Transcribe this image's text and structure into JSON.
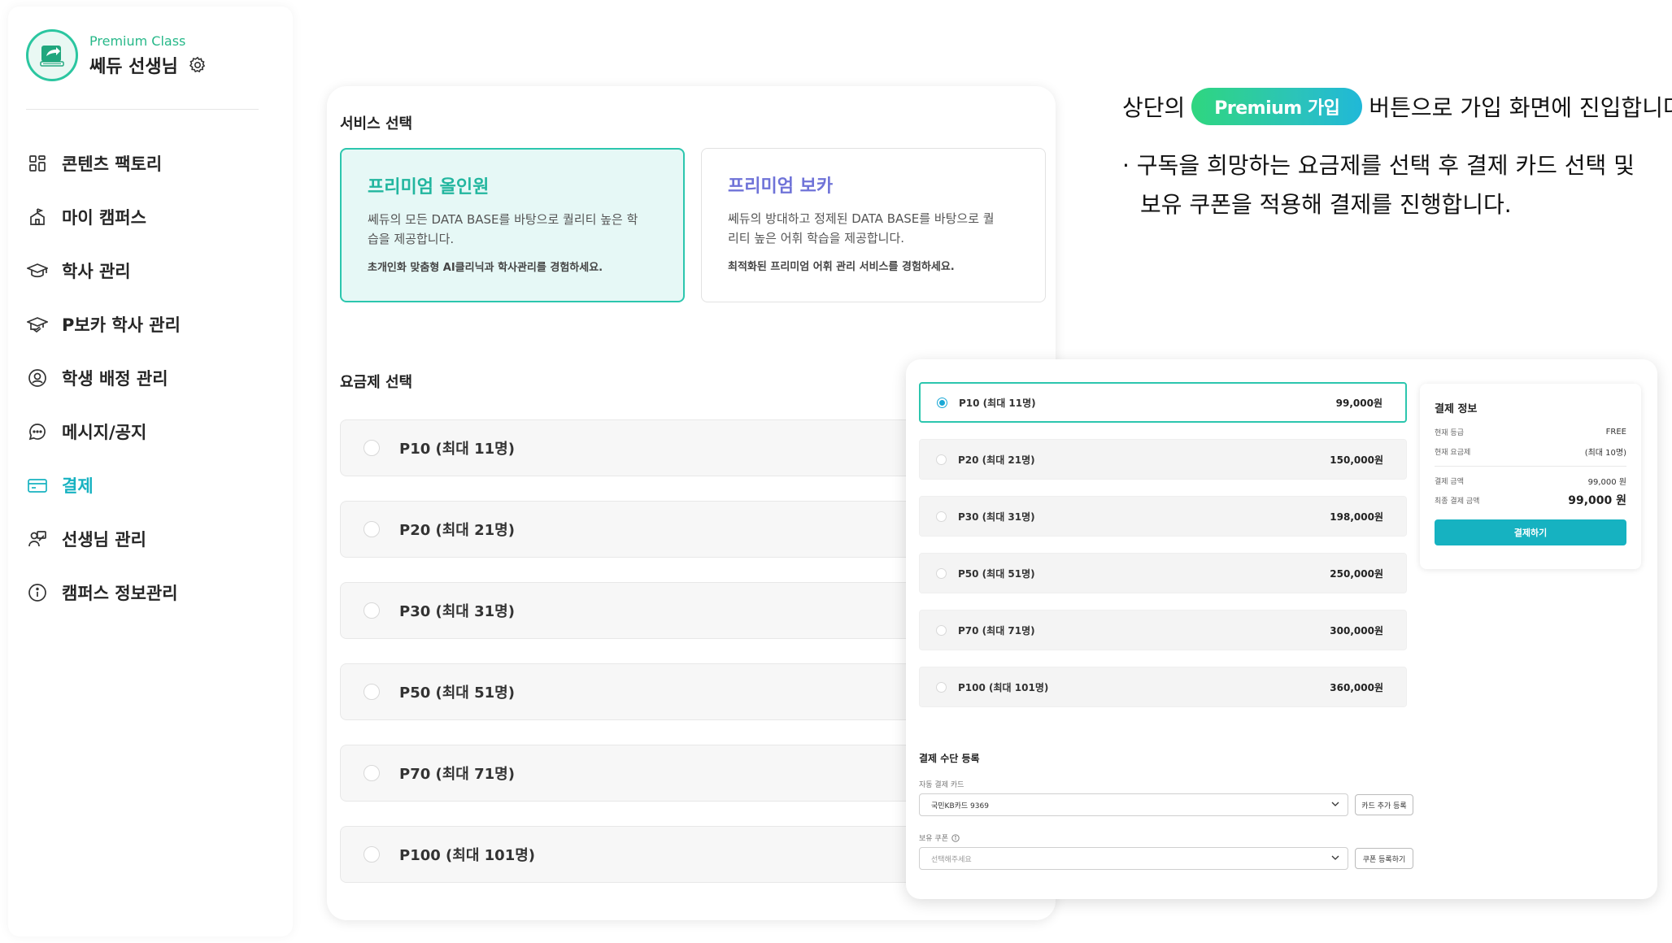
{
  "profile": {
    "class_label": "Premium Class",
    "name": "쎄듀 선생님"
  },
  "menu": [
    {
      "label": "콘텐츠 팩토리",
      "icon": "content-factory-icon"
    },
    {
      "label": "마이 캠퍼스",
      "icon": "campus-icon"
    },
    {
      "label": "학사 관리",
      "icon": "graduation-cap-icon"
    },
    {
      "label": "P보카 학사 관리",
      "icon": "graduation-cap-book-icon"
    },
    {
      "label": "학생 배정 관리",
      "icon": "student-assign-icon"
    },
    {
      "label": "메시지/공지",
      "icon": "message-icon"
    },
    {
      "label": "결제",
      "icon": "credit-card-icon",
      "active": true
    },
    {
      "label": "선생님 관리",
      "icon": "teacher-icon"
    },
    {
      "label": "캠퍼스 정보관리",
      "icon": "info-icon"
    }
  ],
  "main": {
    "service_title": "서비스 선택",
    "services": [
      {
        "title": "프리미엄 올인원",
        "desc": "쎄듀의 모든 DATA BASE를 바탕으로 퀄리티 높은 학습을 제공합니다.",
        "note": "초개인화 맞춤형 AI클리닉과 학사관리를 경험하세요."
      },
      {
        "title": "프리미엄 보카",
        "desc": "쎄듀의 방대하고 정제된 DATA BASE를 바탕으로 퀄리티 높은 어휘 학습을 제공합니다.",
        "note": "최적화된 프리미엄 어휘 관리 서비스를 경험하세요."
      }
    ],
    "plan_title": "요금제 선택",
    "plans": [
      "P10 (최대 11명)",
      "P20 (최대 21명)",
      "P30 (최대 31명)",
      "P50 (최대 51명)",
      "P70 (최대 71명)",
      "P100 (최대 101명)"
    ]
  },
  "overlay": {
    "plans": [
      {
        "label": "P10 (최대 11명)",
        "price": "99,000원",
        "selected": true
      },
      {
        "label": "P20 (최대 21명)",
        "price": "150,000원"
      },
      {
        "label": "P30 (최대 31명)",
        "price": "198,000원"
      },
      {
        "label": "P50 (최대 51명)",
        "price": "250,000원"
      },
      {
        "label": "P70 (최대 71명)",
        "price": "300,000원"
      },
      {
        "label": "P100 (최대 101명)",
        "price": "360,000원"
      }
    ],
    "payment_info": {
      "title": "결제 정보",
      "current_grade_label": "현재 등급",
      "current_grade": "FREE",
      "current_plan_label": "현재 요금제",
      "current_plan": "(최대 10명)",
      "amount_label": "결제 금액",
      "amount": "99,000 원",
      "final_label": "최종 결제 금액",
      "final_amount": "99,000 원",
      "pay_button": "결제하기"
    },
    "register": {
      "title": "결제 수단 등록",
      "card_label": "자동 결제 카드",
      "card_value": "국민KB카드 9369",
      "add_card_button": "카드 추가 등록",
      "coupon_label": "보유 쿠폰",
      "coupon_placeholder": "선택해주세요",
      "coupon_button": "쿠폰 등록하기"
    }
  },
  "annotation": {
    "prefix": "상단의",
    "pill": "Premium 가입",
    "suffix": "버튼으로 가입 화면에 진입합니다.",
    "line2": "· 구독을 희망하는 요금제를 선택 후 결제 카드 선택 및",
    "line3": "보유 쿠폰을 적용해 결제를 진행합니다."
  },
  "colors": {
    "accent": "#17b2c1",
    "green": "#22b69f",
    "purple": "#6f73d8"
  }
}
